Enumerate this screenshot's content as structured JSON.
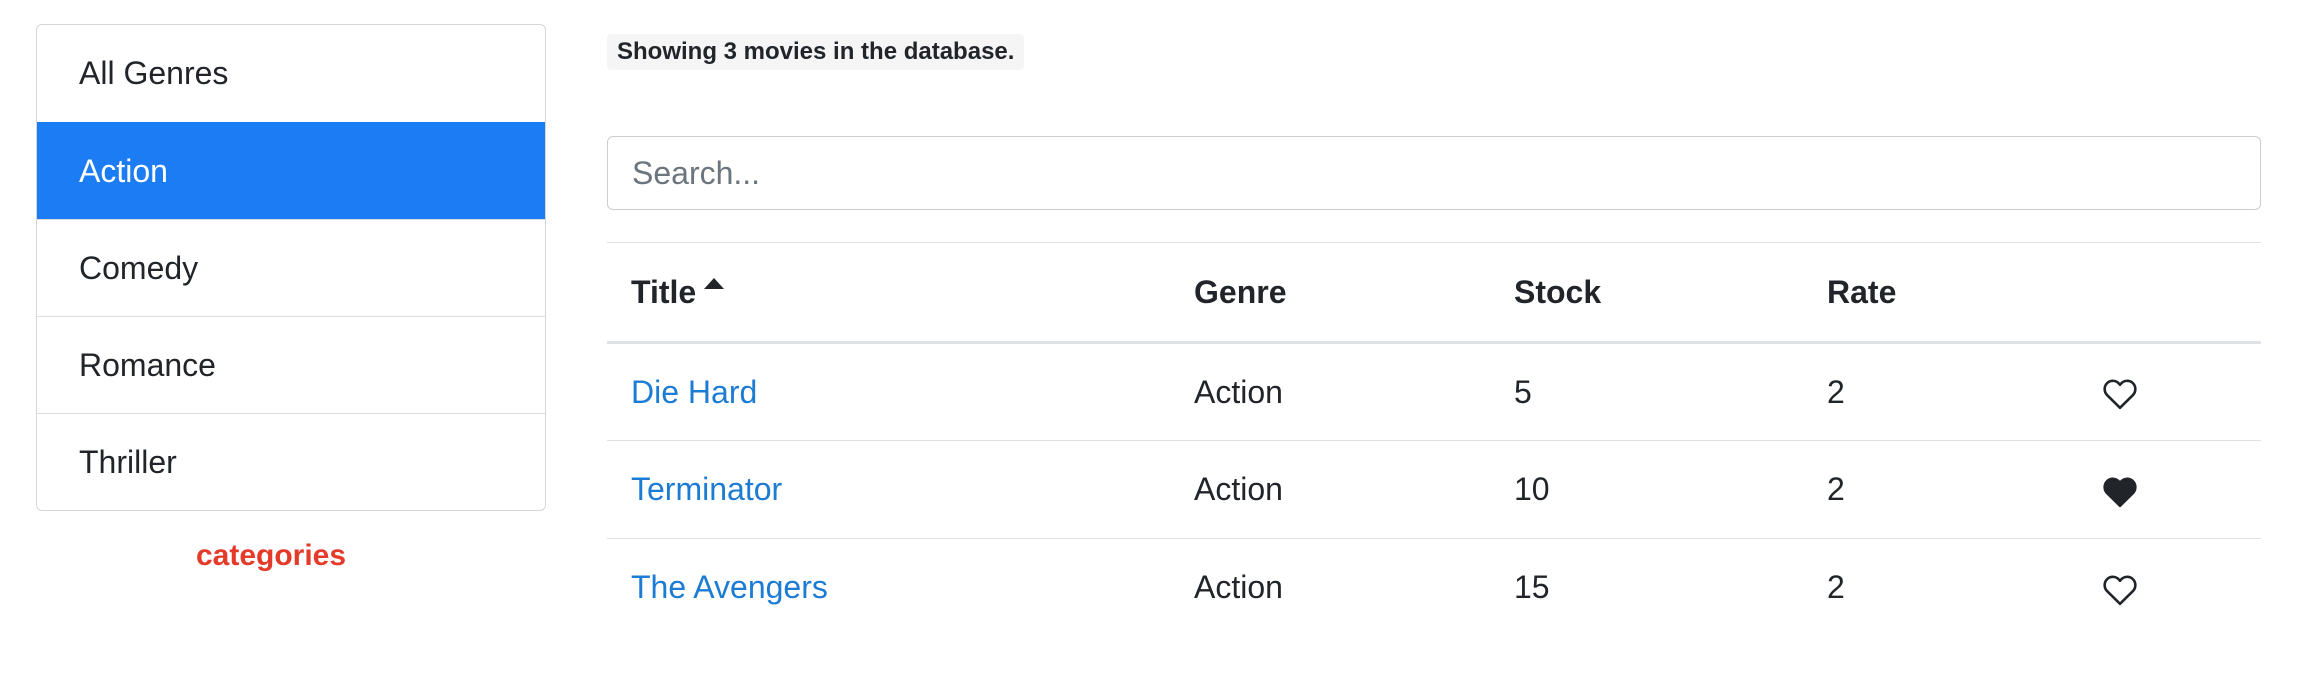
{
  "sidebar": {
    "genres": [
      {
        "label": "All Genres",
        "active": false
      },
      {
        "label": "Action",
        "active": true
      },
      {
        "label": "Comedy",
        "active": false
      },
      {
        "label": "Romance",
        "active": false
      },
      {
        "label": "Thriller",
        "active": false
      }
    ],
    "caption": "categories"
  },
  "main": {
    "count_text": "Showing 3 movies in the database.",
    "search": {
      "placeholder": "Search...",
      "value": ""
    },
    "table": {
      "columns": [
        "Title",
        "Genre",
        "Stock",
        "Rate"
      ],
      "sort_icon": "caret-up-icon",
      "rows": [
        {
          "title": "Die Hard",
          "genre": "Action",
          "stock": "5",
          "rate": "2",
          "liked": false
        },
        {
          "title": "Terminator",
          "genre": "Action",
          "stock": "10",
          "rate": "2",
          "liked": true
        },
        {
          "title": "The Avengers",
          "genre": "Action",
          "stock": "15",
          "rate": "2",
          "liked": false
        }
      ]
    }
  },
  "colors": {
    "accent": "#1c7cf4",
    "link": "#1c7cd4",
    "caption": "#e53a2a"
  }
}
